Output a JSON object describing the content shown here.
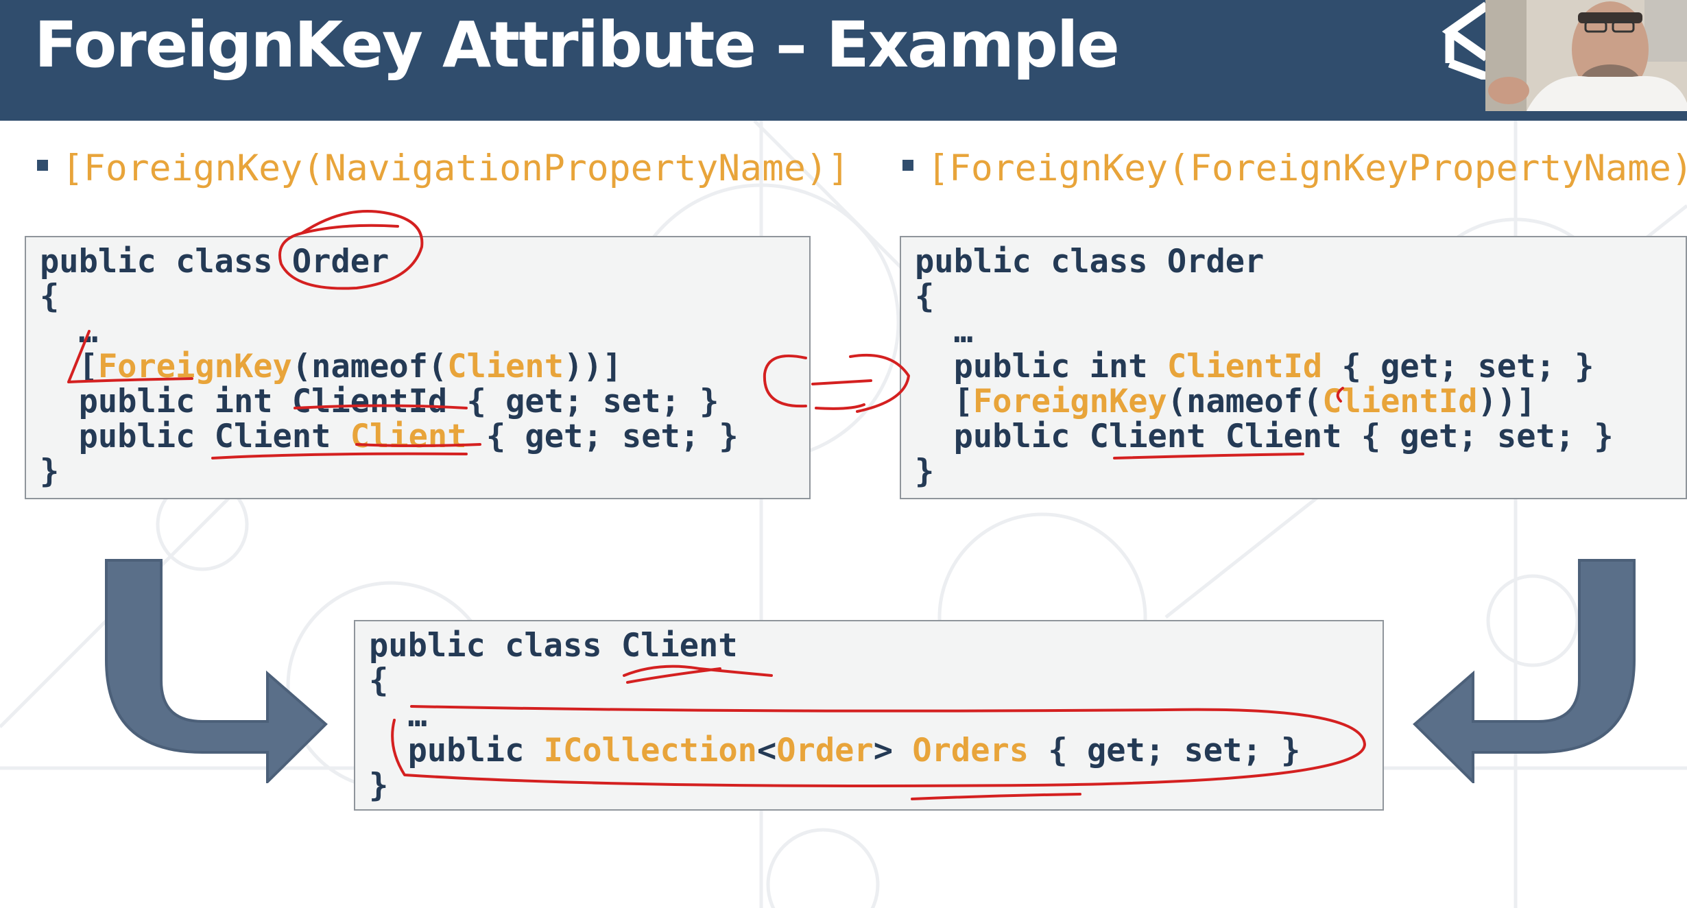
{
  "slide": {
    "title": "ForeignKey Attribute – Example",
    "bullets": [
      {
        "text": "[ForeignKey(NavigationPropertyName)]"
      },
      {
        "text": "[ForeignKey(ForeignKeyPropertyName)]"
      }
    ]
  },
  "code_left": {
    "line1": "public class Order",
    "open": "{",
    "ellipsis": "…",
    "attr_open": "[",
    "attr_name": "ForeignKey",
    "attr_nameof": "(nameof(",
    "attr_arg": "Client",
    "attr_close": "))]",
    "prop1": "public int ClientId { get; set; }",
    "prop2_a": "public Client ",
    "prop2_name": "Client",
    "prop2_b": " { get; set; }",
    "close": "}"
  },
  "code_right": {
    "line1": "public class Order",
    "open": "{",
    "ellipsis": "…",
    "prop1_a": "public int ",
    "prop1_name": "ClientId",
    "prop1_b": " { get; set; }",
    "attr_open": "[",
    "attr_name": "ForeignKey",
    "attr_nameof": "(nameof(",
    "attr_arg": "ClientId",
    "attr_close": "))]",
    "prop2": "public Client Client { get; set; }",
    "close": "}"
  },
  "code_bottom": {
    "line1": "public class Client",
    "open": "{",
    "ellipsis": "…",
    "prop_a": "public ",
    "prop_type": "ICollection",
    "prop_lt": "<",
    "prop_generic": "Order",
    "prop_gt": "> ",
    "prop_name": "Orders",
    "prop_b": " { get; set; }",
    "close": "}"
  },
  "colors": {
    "title_bar": "#304d6d",
    "code_text": "#243a55",
    "highlight": "#e8a43a",
    "arrow": "#5a6f89",
    "annotation_ink": "#d42020"
  },
  "icons": [
    "app-logo-icon",
    "curved-arrow-left-icon",
    "curved-arrow-right-icon"
  ]
}
